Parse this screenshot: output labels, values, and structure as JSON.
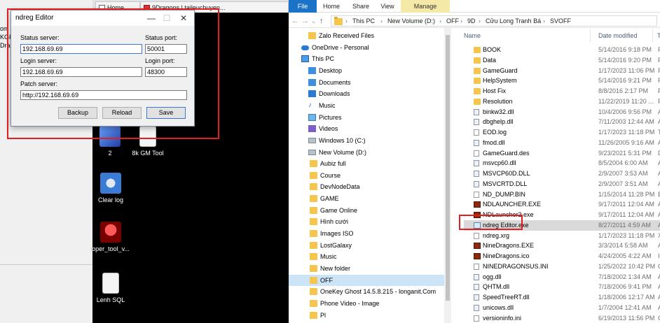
{
  "left_app": {
    "fragments": [
      "om",
      "KGH",
      "Drag"
    ]
  },
  "browser_tabs": [
    {
      "label": "Home"
    },
    {
      "label": "9Dragons | taileuchuyen..."
    }
  ],
  "desktop_icons": [
    {
      "label": "2"
    },
    {
      "label": "8k GM Tool"
    },
    {
      "label": "Clear log"
    },
    {
      "label": "oper_tool_v..."
    },
    {
      "label": "Lenh SQL"
    }
  ],
  "editor": {
    "title": "ndreg Editor",
    "controls": {
      "minimize": "—",
      "maximize": "☐",
      "close": "✕"
    },
    "status_server_label": "Status server:",
    "status_server_value": "192.168.69.69",
    "status_port_label": "Status port:",
    "status_port_value": "50001",
    "login_server_label": "Login server:",
    "login_server_value": "192.168.69.69",
    "login_port_label": "Login port:",
    "login_port_value": "48300",
    "patch_server_label": "Patch server:",
    "patch_server_value": "http://192.168.69.69",
    "buttons": {
      "backup": "Backup",
      "reload": "Reload",
      "save": "Save"
    }
  },
  "explorer": {
    "ribbon_tabs": {
      "file": "File",
      "home": "Home",
      "share": "Share",
      "view": "View",
      "manage": "Manage"
    },
    "nav_buttons": {
      "back": "←",
      "forward": "→",
      "recent": "⌄",
      "up": "↑"
    },
    "breadcrumb": [
      "This PC",
      "New Volume (D:)",
      "OFF",
      "9D",
      "Cửu Long Tranh Bá",
      "SVOFF"
    ],
    "nav_items": [
      {
        "label": "Zalo Received Files",
        "icon": "folder-icon",
        "indent": 1
      },
      {
        "label": "OneDrive - Personal",
        "icon": "cloud-icon",
        "indent": 0
      },
      {
        "label": "This PC",
        "icon": "pc-icon",
        "indent": 0
      },
      {
        "label": "Desktop",
        "icon": "desktop-icon",
        "indent": 1
      },
      {
        "label": "Documents",
        "icon": "documents-icon",
        "indent": 1
      },
      {
        "label": "Downloads",
        "icon": "downloads-icon",
        "indent": 1
      },
      {
        "label": "Music",
        "icon": "music-icon",
        "indent": 1
      },
      {
        "label": "Pictures",
        "icon": "pictures-icon",
        "indent": 1
      },
      {
        "label": "Videos",
        "icon": "videos-icon",
        "indent": 1
      },
      {
        "label": "Windows 10 (C:)",
        "icon": "drive-icon",
        "indent": 1
      },
      {
        "label": "New Volume (D:)",
        "icon": "drive-icon",
        "indent": 1
      },
      {
        "label": "Aubiz full",
        "icon": "folder-icon",
        "indent": 2
      },
      {
        "label": "Course",
        "icon": "folder-icon",
        "indent": 2
      },
      {
        "label": "DevNodeData",
        "icon": "folder-icon",
        "indent": 2
      },
      {
        "label": "GAME",
        "icon": "folder-icon",
        "indent": 2
      },
      {
        "label": "Game Online",
        "icon": "folder-icon",
        "indent": 2
      },
      {
        "label": "Hình cưới",
        "icon": "folder-icon",
        "indent": 2
      },
      {
        "label": "Images ISO",
        "icon": "folder-icon",
        "indent": 2
      },
      {
        "label": "LostGalaxy",
        "icon": "folder-icon",
        "indent": 2
      },
      {
        "label": "Music",
        "icon": "folder-icon",
        "indent": 2
      },
      {
        "label": "New folder",
        "icon": "folder-icon",
        "indent": 2
      },
      {
        "label": "OFF",
        "icon": "folder-icon",
        "indent": 2,
        "selected": true
      },
      {
        "label": "OneKey Ghost 14.5.8.215 - longanit.Com",
        "icon": "folder-icon",
        "indent": 2
      },
      {
        "label": "Phone Video - Image",
        "icon": "folder-icon",
        "indent": 2
      },
      {
        "label": "Pl",
        "icon": "folder-icon",
        "indent": 2
      }
    ],
    "columns": {
      "name": "Name",
      "date": "Date modified",
      "type": "Type"
    },
    "files": [
      {
        "name": "BOOK",
        "date": "5/14/2016 9:18 PM",
        "type": "File",
        "kind": "folder"
      },
      {
        "name": "Data",
        "date": "5/14/2016 9:20 PM",
        "type": "File",
        "kind": "folder"
      },
      {
        "name": "GameGuard",
        "date": "1/17/2023 11:06 PM",
        "type": "File",
        "kind": "folder"
      },
      {
        "name": "HelpSystem",
        "date": "5/14/2016 9:21 PM",
        "type": "File",
        "kind": "folder"
      },
      {
        "name": "Host Fix",
        "date": "8/8/2016 2:17 PM",
        "type": "File",
        "kind": "folder"
      },
      {
        "name": "Resolution",
        "date": "11/22/2019 11:20 ...",
        "type": "File",
        "kind": "folder"
      },
      {
        "name": "binkw32.dll",
        "date": "10/4/2006 9:56 PM",
        "type": "App",
        "kind": "dll"
      },
      {
        "name": "dbghelp.dll",
        "date": "7/11/2003 12:44 AM",
        "type": "App",
        "kind": "dll"
      },
      {
        "name": "EOD.log",
        "date": "1/17/2023 11:18 PM",
        "type": "Text",
        "kind": "file"
      },
      {
        "name": "fmod.dll",
        "date": "11/26/2005 9:16 AM",
        "type": "App",
        "kind": "dll"
      },
      {
        "name": "GameGuard.des",
        "date": "9/23/2021 5:31 PM",
        "type": "DES",
        "kind": "file"
      },
      {
        "name": "msvcp60.dll",
        "date": "8/5/2004 6:00 AM",
        "type": "App",
        "kind": "dll"
      },
      {
        "name": "MSVCP60D.DLL",
        "date": "2/9/2007 3:53 AM",
        "type": "App",
        "kind": "dll"
      },
      {
        "name": "MSVCRTD.DLL",
        "date": "2/9/2007 3:51 AM",
        "type": "App",
        "kind": "dll"
      },
      {
        "name": "ND_DUMP.BIN",
        "date": "1/15/2014 11:28 PM",
        "type": "BIN",
        "kind": "file"
      },
      {
        "name": "NDLAUNCHER.EXE",
        "date": "9/17/2011 12:04 AM",
        "type": "App",
        "kind": "game"
      },
      {
        "name": "NDLauncher2.exe",
        "date": "9/17/2011 12:04 AM",
        "type": "App",
        "kind": "game"
      },
      {
        "name": "ndreg Editor.exe",
        "date": "8/27/2011 4:59 AM",
        "type": "App",
        "kind": "ndreg",
        "selected": true
      },
      {
        "name": "ndreg.xrg",
        "date": "1/17/2023 11:18 PM",
        "type": "XRG",
        "kind": "file"
      },
      {
        "name": "NineDragons.EXE",
        "date": "3/3/2014 5:58 AM",
        "type": "App",
        "kind": "game"
      },
      {
        "name": "NineDragons.ico",
        "date": "4/24/2005 4:22 AM",
        "type": "Icon",
        "kind": "game"
      },
      {
        "name": "NINEDRAGONSUS.INI",
        "date": "1/25/2022 10:42 PM",
        "type": "Con",
        "kind": "file"
      },
      {
        "name": "ogg.dll",
        "date": "7/18/2002 1:34 AM",
        "type": "App",
        "kind": "dll"
      },
      {
        "name": "QHTM.dll",
        "date": "7/18/2006 9:41 PM",
        "type": "App",
        "kind": "dll"
      },
      {
        "name": "SpeedTreeRT.dll",
        "date": "1/18/2006 12:17 AM",
        "type": "App",
        "kind": "dll"
      },
      {
        "name": "unicows.dll",
        "date": "1/7/2004 12:41 AM",
        "type": "App",
        "kind": "dll"
      },
      {
        "name": "versioninfo.ini",
        "date": "6/19/2013 11:56 PM",
        "type": "Con",
        "kind": "file"
      }
    ]
  }
}
